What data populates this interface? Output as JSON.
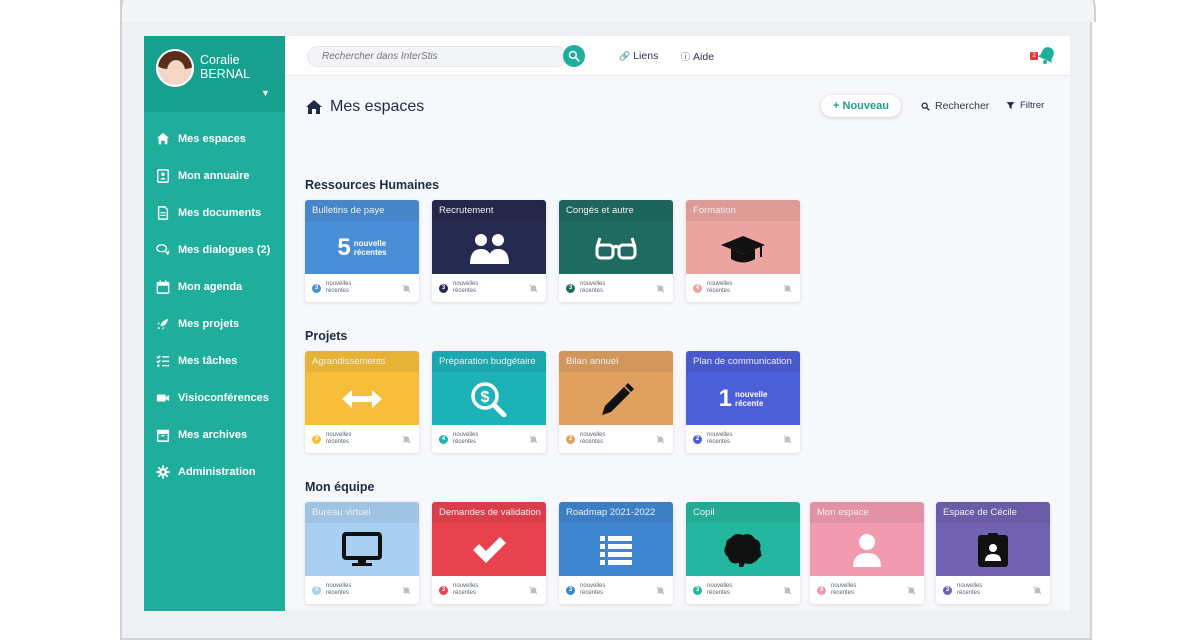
{
  "user": {
    "first_name": "Coralie",
    "last_name": "BERNAL"
  },
  "sidebar": {
    "items": [
      {
        "label": "Mes espaces",
        "icon": "home-icon"
      },
      {
        "label": "Mon annuaire",
        "icon": "address-book-icon"
      },
      {
        "label": "Mes documents",
        "icon": "document-icon"
      },
      {
        "label": "Mes dialogues (2)",
        "icon": "chat-icon"
      },
      {
        "label": "Mon agenda",
        "icon": "calendar-icon"
      },
      {
        "label": "Mes projets",
        "icon": "rocket-icon"
      },
      {
        "label": "Mes tâches",
        "icon": "tasks-icon"
      },
      {
        "label": "Visioconférences",
        "icon": "video-icon"
      },
      {
        "label": "Mes archives",
        "icon": "archive-icon"
      },
      {
        "label": "Administration",
        "icon": "gear-icon"
      }
    ]
  },
  "topbar": {
    "search_placeholder": "Rechercher dans InterStis",
    "links_label": "Liens",
    "help_label": "Aide",
    "notification_count": "2"
  },
  "page": {
    "title": "Mes espaces",
    "new_label": "+ Nouveau",
    "search_label": "Rechercher",
    "filter_label": "Filtrer"
  },
  "footer_text": {
    "line1": "nouvelles",
    "line2": "récentes"
  },
  "colors": {
    "accent": "#1fae9b"
  },
  "sections": [
    {
      "title": "Ressources Humaines",
      "cards": [
        {
          "title": "Bulletins de paye",
          "color": "#4a8fd6",
          "badge_color": "#4a8fd6",
          "count": "3",
          "icon": "recent-count",
          "recent_num": "5",
          "recent_l1": "nouvelle",
          "recent_l2": "récentes"
        },
        {
          "title": "Recrutement",
          "color": "#262a4f",
          "badge_color": "#262a4f",
          "count": "3",
          "icon": "users-icon"
        },
        {
          "title": "Congés et autre",
          "color": "#1f6b62",
          "badge_color": "#1f6b62",
          "count": "3",
          "icon": "glasses-icon"
        },
        {
          "title": "Formation",
          "color": "#eba4a0",
          "badge_color": "#eba4a0",
          "count": "4",
          "icon": "graduation-cap-icon"
        }
      ]
    },
    {
      "title": "Projets",
      "cards": [
        {
          "title": "Agrandissements",
          "color": "#f6be3a",
          "badge_color": "#f6be3a",
          "count": "3",
          "icon": "arrows-horizontal-icon"
        },
        {
          "title": "Préparation budgétaire",
          "color": "#1db2b8",
          "badge_color": "#1db2b8",
          "count": "4",
          "icon": "dollar-search-icon"
        },
        {
          "title": "Bilan annuel",
          "color": "#e0a060",
          "badge_color": "#e0a060",
          "count": "2",
          "icon": "pencil-icon"
        },
        {
          "title": "Plan de communication",
          "color": "#4d5fd8",
          "badge_color": "#4d5fd8",
          "count": "2",
          "icon": "recent-count",
          "recent_num": "1",
          "recent_l1": "nouvelle",
          "recent_l2": "récente"
        }
      ]
    },
    {
      "title": "Mon équipe",
      "cards": [
        {
          "title": "Bureau virtuel",
          "color": "#a8cff2",
          "badge_color": "#a8cff2",
          "count": "3",
          "icon": "monitor-icon"
        },
        {
          "title": "Demandes de validation",
          "color": "#e8424f",
          "badge_color": "#e8424f",
          "count": "3",
          "icon": "checkmark-icon"
        },
        {
          "title": "Roadmap 2021-2022",
          "color": "#3f86d0",
          "badge_color": "#3f86d0",
          "count": "3",
          "icon": "list-icon"
        },
        {
          "title": "Copil",
          "color": "#25b69f",
          "badge_color": "#25b69f",
          "count": "3",
          "icon": "brain-icon"
        },
        {
          "title": "Mon espace",
          "color": "#f29ab0",
          "badge_color": "#f29ab0",
          "count": "3",
          "icon": "user-icon"
        },
        {
          "title": "Espace de Cécile",
          "color": "#7262b3",
          "badge_color": "#7262b3",
          "count": "3",
          "icon": "id-badge-icon"
        }
      ]
    }
  ]
}
